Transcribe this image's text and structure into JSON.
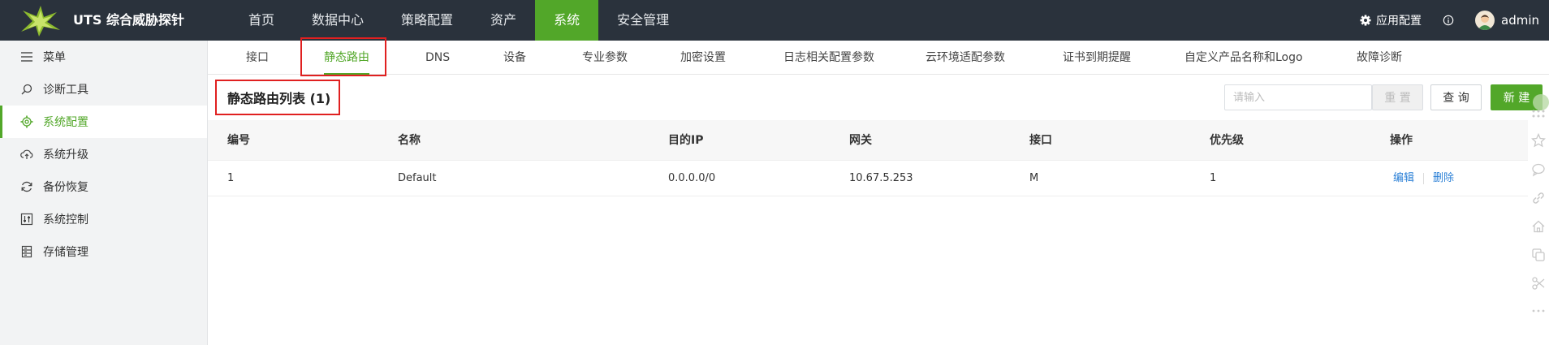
{
  "header": {
    "brand": "UTS 综合威胁探针",
    "nav": [
      "首页",
      "数据中心",
      "策略配置",
      "资产",
      "系统",
      "安全管理"
    ],
    "active_nav": "系统",
    "app_config": "应用配置",
    "username": "admin"
  },
  "sidebar": {
    "items": [
      {
        "label": "菜单",
        "icon": "menu-icon"
      },
      {
        "label": "诊断工具",
        "icon": "search-icon"
      },
      {
        "label": "系统配置",
        "icon": "gear-icon"
      },
      {
        "label": "系统升级",
        "icon": "cloud-upload-icon"
      },
      {
        "label": "备份恢复",
        "icon": "refresh-icon"
      },
      {
        "label": "系统控制",
        "icon": "control-icon"
      },
      {
        "label": "存储管理",
        "icon": "storage-icon"
      }
    ],
    "active_item": "系统配置"
  },
  "subtabs": [
    "接口",
    "静态路由",
    "DNS",
    "设备",
    "专业参数",
    "加密设置",
    "日志相关配置参数",
    "云环境适配参数",
    "证书到期提醒",
    "自定义产品名称和Logo",
    "故障诊断"
  ],
  "active_subtab": "静态路由",
  "list": {
    "title": "静态路由列表 (1)",
    "search_placeholder": "请输入",
    "reset_label": "重 置",
    "query_label": "查 询",
    "new_label": "新 建"
  },
  "table": {
    "columns": [
      "编号",
      "名称",
      "目的IP",
      "网关",
      "接口",
      "优先级",
      "操作"
    ],
    "rows": [
      {
        "id": "1",
        "name": "Default",
        "dest_ip": "0.0.0.0/0",
        "gateway": "10.67.5.253",
        "iface": "M",
        "priority": "1",
        "edit": "编辑",
        "delete": "删除"
      }
    ]
  },
  "colors": {
    "topbar": "#2a323c",
    "accent": "#52a729",
    "link": "#2a7fd6",
    "highlight": "#e02020"
  },
  "right_toolbar_icons": [
    "grid-icon",
    "star-icon",
    "comment-icon",
    "link-icon",
    "home-icon",
    "copy-icon",
    "scissors-icon",
    "more-icon"
  ]
}
